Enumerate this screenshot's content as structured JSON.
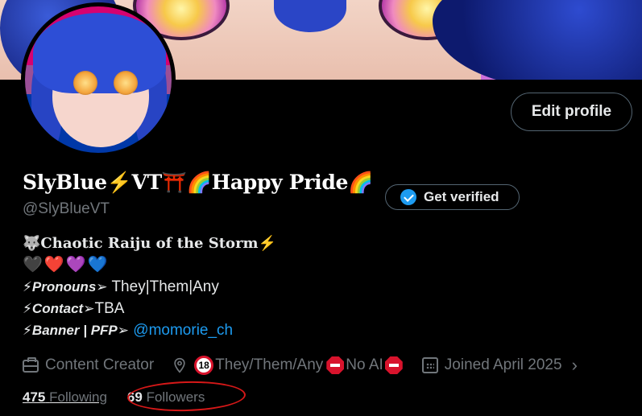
{
  "profile": {
    "display_name": "SlyBlue⚡VT⛩️🌈Happy Pride🌈",
    "handle": "@SlyBlueVT",
    "edit_label": "Edit profile",
    "verify_label": "Get verified"
  },
  "bio": {
    "line1": "🐺Chaotic Raiju of the Storm⚡",
    "hearts": [
      "🖤",
      "❤️",
      "💜",
      "💙"
    ],
    "pronouns_label": "⚡Pronouns➢",
    "pronouns_value": " They|Them|Any",
    "contact_label": "⚡Contact➢",
    "contact_value": "TBA",
    "banner_label": "⚡Banner | PFP➢",
    "banner_link": "@momorie_ch"
  },
  "meta": {
    "category": "Content Creator",
    "location": "They/Them/Any",
    "location_suffix": "No AI",
    "joined": "Joined April 2025"
  },
  "stats": {
    "following_count": "475",
    "following_label": "Following",
    "followers_count": "69",
    "followers_label": "Followers"
  },
  "colors": {
    "background": "#000000",
    "text": "#e7e9ea",
    "muted": "#71767b",
    "link": "#1d9bf0",
    "border": "#536471",
    "annotation": "#d61818"
  }
}
